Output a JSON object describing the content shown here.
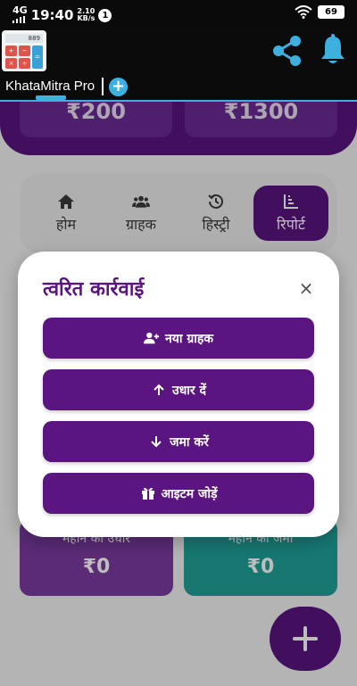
{
  "status_bar": {
    "network": "4G",
    "time": "19:40",
    "speed_value": "2.10",
    "speed_unit": "KB/s",
    "notification_count": "1",
    "battery": "69"
  },
  "app_header": {
    "logo_display": "889",
    "icons": [
      "share-icon",
      "bell-icon"
    ]
  },
  "tabs": {
    "active_label": "KhataMitra Pro",
    "add_symbol": "+"
  },
  "summary": {
    "left_amount": "₹200",
    "right_amount": "₹1300"
  },
  "bottom_nav": {
    "items": [
      {
        "label": "होम",
        "icon": "home-icon"
      },
      {
        "label": "ग्राहक",
        "icon": "users-icon"
      },
      {
        "label": "हिस्ट्री",
        "icon": "history-icon"
      },
      {
        "label": "रिपोर्ट",
        "icon": "report-icon"
      }
    ],
    "active_index": 3
  },
  "stats": {
    "left": {
      "label": "महीने का उधार",
      "value": "₹0"
    },
    "right": {
      "label": "महीने का जमा",
      "value": "₹0"
    }
  },
  "fab": {
    "symbol": "+"
  },
  "modal": {
    "title": "त्वरित कार्रवाई",
    "close_symbol": "×",
    "actions": [
      {
        "label": "नया ग्राहक",
        "icon": "user-plus-icon"
      },
      {
        "label": "उधार दें",
        "icon": "arrow-up-icon"
      },
      {
        "label": "जमा करें",
        "icon": "arrow-down-icon"
      },
      {
        "label": "आइटम जोड़ें",
        "icon": "gift-icon"
      }
    ]
  },
  "colors": {
    "primary": "#5a1580",
    "accent": "#3db0e0",
    "teal": "#1fa39a"
  }
}
